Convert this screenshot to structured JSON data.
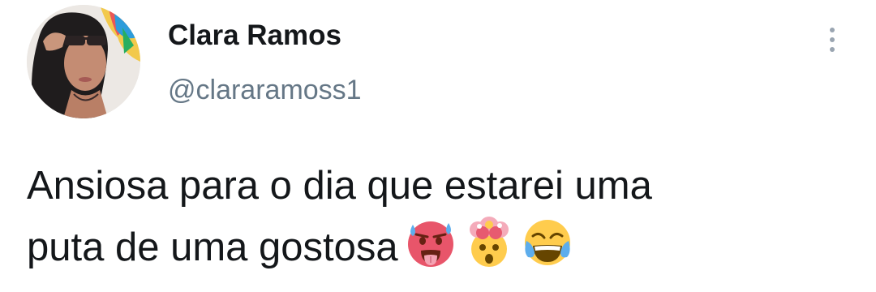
{
  "tweet": {
    "author_name": "Clara Ramos",
    "author_handle": "@clararamoss1",
    "text_line1": "Ansiosa para o dia que estarei uma",
    "text_line2": "puta de uma gostosa",
    "emojis": [
      "hot-face-emoji",
      "exploding-head-emoji",
      "tears-of-joy-emoji"
    ]
  },
  "icons": {
    "menu": "more-vertical-icon"
  },
  "colors": {
    "name": "#14171a",
    "handle": "#657786",
    "menu": "#9aa5b1"
  }
}
